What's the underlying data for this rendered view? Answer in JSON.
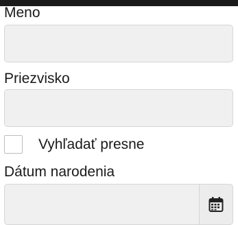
{
  "form": {
    "first_name": {
      "label": "Meno",
      "value": "",
      "placeholder": ""
    },
    "last_name": {
      "label": "Priezvisko",
      "value": "",
      "placeholder": ""
    },
    "exact_search": {
      "label": "Vyhľadať presne",
      "checked": false
    },
    "birth_date": {
      "label": "Dátum narodenia",
      "value": "",
      "placeholder": "",
      "icon": "calendar-icon"
    }
  }
}
